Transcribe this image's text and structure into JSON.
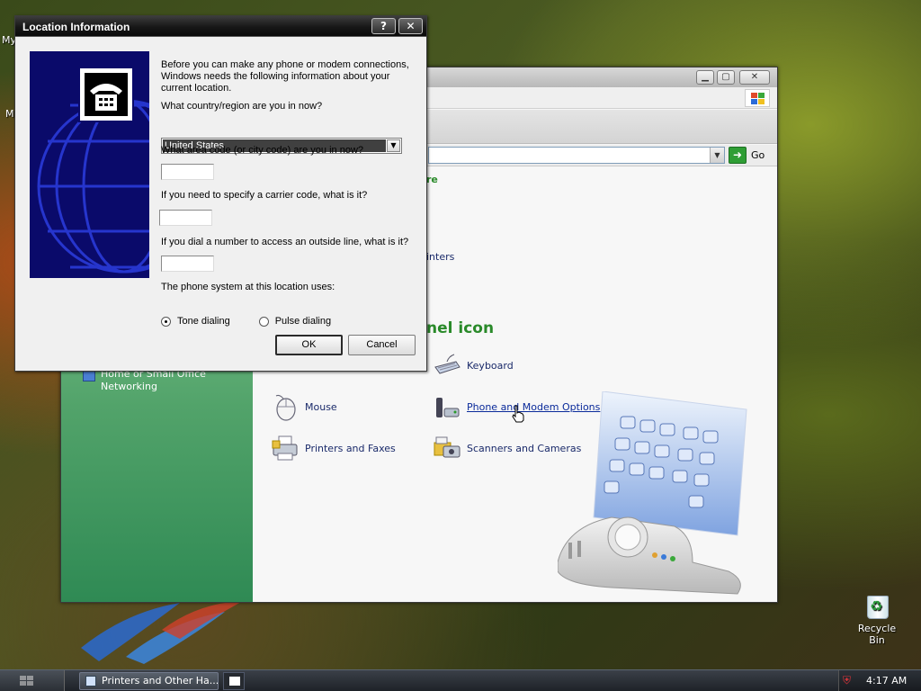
{
  "desktop": {
    "icons": [
      {
        "label": "Recycle Bin"
      }
    ],
    "partial_labels": [
      "My",
      "M"
    ]
  },
  "explorer": {
    "go_label": "Go",
    "fragments": {
      "heading1_fragment": "re",
      "printers_fragment": "inters",
      "heading2_fragment": "nel icon"
    },
    "left_link": "Home or Small Office Networking",
    "items": [
      {
        "label": "Keyboard",
        "icon": "keyboard-icon"
      },
      {
        "label": "Mouse",
        "icon": "mouse-icon"
      },
      {
        "label": "Phone and Modem Options",
        "icon": "phone-modem-icon"
      },
      {
        "label": "Printers and Faxes",
        "icon": "printer-icon"
      },
      {
        "label": "Scanners and Cameras",
        "icon": "scanner-icon"
      }
    ]
  },
  "dialog": {
    "title": "Location Information",
    "help_label": "?",
    "close_label": "✕",
    "intro": "Before you can make any phone or modem connections, Windows needs the following information about your current location.",
    "q_country": "What country/region are you in now?",
    "country_value": "United States",
    "q_area": "What area code (or city code) are you in now?",
    "area_value": "",
    "q_carrier": "If you need to specify a carrier code, what is it?",
    "carrier_value": "",
    "q_outside": "If you dial a number to access an outside line, what is it?",
    "outside_value": "",
    "q_system": "The phone system at this location uses:",
    "radio_tone": "Tone dialing",
    "radio_pulse": "Pulse dialing",
    "selected_dialing": "Tone dialing",
    "ok_label": "OK",
    "cancel_label": "Cancel"
  },
  "taskbar": {
    "task_label": "Printers and Other Ha...",
    "clock": "4:17 AM"
  }
}
